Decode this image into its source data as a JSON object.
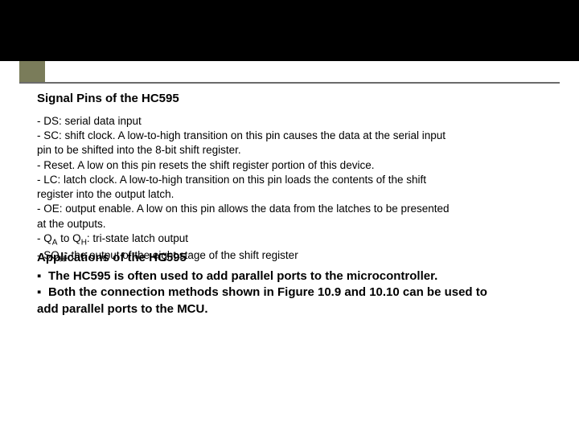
{
  "title1": "Signal Pins of the HC595",
  "pins": {
    "l1": "-   DS:  serial data input",
    "l2": "-   SC:  shift clock. A low-to-high transition on this pin causes the data at the serial input",
    "l3": "pin          to be shifted into the 8-bit shift register.",
    "l4": "-   Reset. A low on this pin resets the shift register portion of this device.",
    "l5": "-   LC:  latch clock. A low-to-high transition on this pin loads the contents of the shift",
    "l6": "register                   into the output latch.",
    "l7": "-   OE:  output enable. A low on this pin allows the data from the latches to be presented",
    "l8": "at          the outputs.",
    "l9a": "-   Q",
    "l9b": " to Q",
    "l9c": ": tri-state latch output",
    "l9subA": "A",
    "l9subH": "H",
    "l10a": "-   SQ",
    "l10b": ": the output of the eight stage of the shift register",
    "l10sub": "H"
  },
  "title2": "Applications of the HC595",
  "apps": {
    "b": "▪",
    "a1": "The HC595 is often used to add parallel ports to the microcontroller.",
    "a2": "Both the connection methods shown in Figure 10.9 and 10.10 can be used to",
    "a3": "add parallel ports to the MCU."
  }
}
